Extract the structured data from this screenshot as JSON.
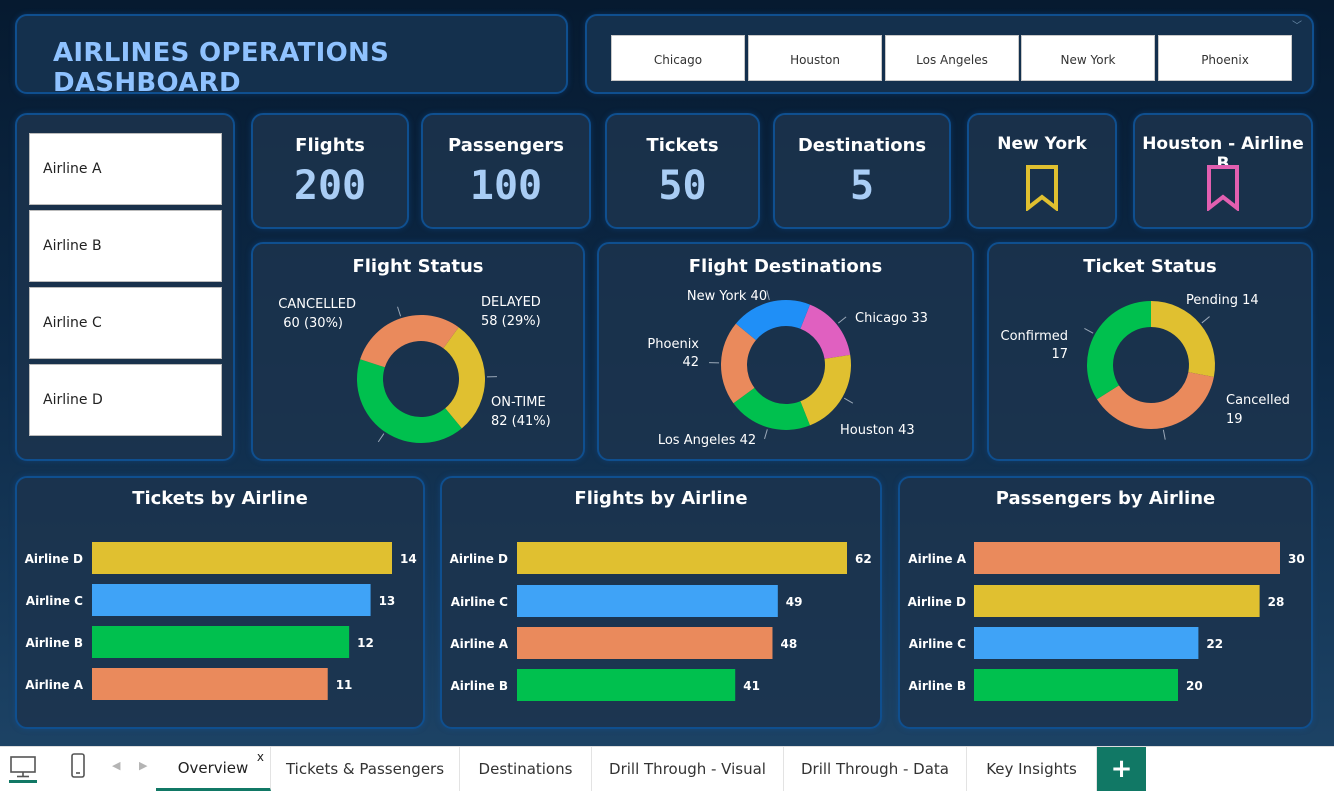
{
  "title": "AIRLINES OPERATIONS DASHBOARD",
  "city_filter": [
    "Chicago",
    "Houston",
    "Los Angeles",
    "New York",
    "Phoenix"
  ],
  "airline_filter": [
    "Airline A",
    "Airline B",
    "Airline C",
    "Airline D"
  ],
  "kpis": {
    "flights": {
      "label": "Flights",
      "value": "200"
    },
    "passengers": {
      "label": "Passengers",
      "value": "100"
    },
    "tickets": {
      "label": "Tickets",
      "value": "50"
    },
    "destinations": {
      "label": "Destinations",
      "value": "5"
    }
  },
  "bookmarks": {
    "city": {
      "label": "New York",
      "color": "#e0c030"
    },
    "route": {
      "label": "Houston - Airline B",
      "color": "#e25fb0"
    }
  },
  "colors": {
    "yellow": "#e0c030",
    "green": "#00c04e",
    "orange": "#ea8a5c",
    "blue": "#1f8ff7",
    "light_blue": "#3fa3f7",
    "pink": "#e060c0",
    "panel_border": "#0f4f8f",
    "tab_accent": "#117865"
  },
  "chart_data": [
    {
      "id": "flight_status",
      "type": "pie",
      "title": "Flight Status",
      "labels": [
        "DELAYED",
        "ON-TIME",
        "CANCELLED"
      ],
      "values": [
        58,
        82,
        60
      ],
      "value_labels": [
        "58 (29%)",
        "82 (41%)",
        "60 (30%)"
      ],
      "colors": [
        "#e0c030",
        "#00c04e",
        "#ea8a5c"
      ]
    },
    {
      "id": "flight_destinations",
      "type": "pie",
      "title": "Flight Destinations",
      "labels": [
        "Chicago",
        "Houston",
        "Los Angeles",
        "Phoenix",
        "New York"
      ],
      "values": [
        33,
        43,
        42,
        42,
        40
      ],
      "colors": [
        "#e060c0",
        "#e0c030",
        "#00c04e",
        "#ea8a5c",
        "#1f8ff7"
      ]
    },
    {
      "id": "ticket_status",
      "type": "pie",
      "title": "Ticket Status",
      "labels": [
        "Pending",
        "Cancelled",
        "Confirmed"
      ],
      "values": [
        14,
        19,
        17
      ],
      "colors": [
        "#e0c030",
        "#ea8a5c",
        "#00c04e"
      ]
    },
    {
      "id": "tickets_by_airline",
      "type": "bar",
      "orientation": "horizontal",
      "title": "Tickets by Airline",
      "categories": [
        "Airline D",
        "Airline C",
        "Airline B",
        "Airline A"
      ],
      "values": [
        14,
        13,
        12,
        11
      ],
      "colors": [
        "#e0c030",
        "#3fa3f7",
        "#00c04e",
        "#ea8a5c"
      ]
    },
    {
      "id": "flights_by_airline",
      "type": "bar",
      "orientation": "horizontal",
      "title": "Flights by Airline",
      "categories": [
        "Airline D",
        "Airline C",
        "Airline A",
        "Airline B"
      ],
      "values": [
        62,
        49,
        48,
        41
      ],
      "colors": [
        "#e0c030",
        "#3fa3f7",
        "#ea8a5c",
        "#00c04e"
      ]
    },
    {
      "id": "passengers_by_airline",
      "type": "bar",
      "orientation": "horizontal",
      "title": "Passengers by Airline",
      "categories": [
        "Airline A",
        "Airline D",
        "Airline C",
        "Airline B"
      ],
      "values": [
        30,
        28,
        22,
        20
      ],
      "colors": [
        "#ea8a5c",
        "#e0c030",
        "#3fa3f7",
        "#00c04e"
      ]
    }
  ],
  "tabs": [
    {
      "label": "Overview",
      "active": true,
      "close": "x"
    },
    {
      "label": "Tickets & Passengers"
    },
    {
      "label": "Destinations"
    },
    {
      "label": "Drill Through - Visual"
    },
    {
      "label": "Drill Through - Data"
    },
    {
      "label": "Key Insights"
    }
  ],
  "add_tab_label": "+",
  "icons": {
    "desktop": "desktop-view-icon",
    "phone": "mobile-view-icon",
    "prev": "◀",
    "next": "▶",
    "chevron": "﹀"
  }
}
